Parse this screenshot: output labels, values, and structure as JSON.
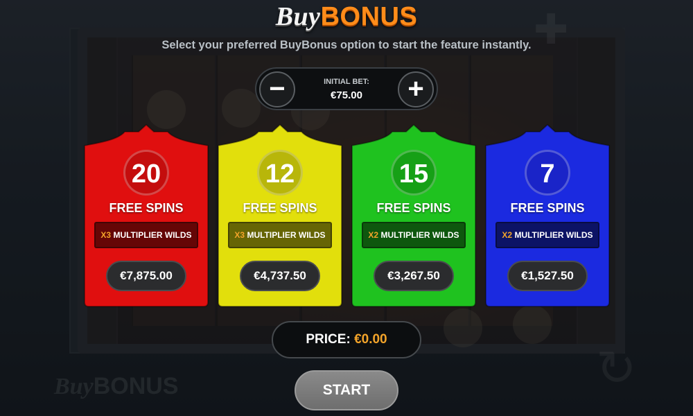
{
  "header": {
    "title_part1": "Buy",
    "title_part2": "BONUS",
    "subtitle": "Select your preferred BuyBonus option to start the feature instantly."
  },
  "bet": {
    "label": "INITIAL BET:",
    "value": "€75.00",
    "minus_symbol": "−",
    "plus_symbol": "+"
  },
  "options": [
    {
      "spins": "20",
      "label": "FREE SPINS",
      "multiplier": "X3",
      "multiplier_text": "MULTIPLIER WILDS",
      "price": "€7,875.00",
      "color": "#e00f0f"
    },
    {
      "spins": "12",
      "label": "FREE SPINS",
      "multiplier": "X3",
      "multiplier_text": "MULTIPLIER WILDS",
      "price": "€4,737.50",
      "color": "#e2df0c"
    },
    {
      "spins": "15",
      "label": "FREE SPINS",
      "multiplier": "X2",
      "multiplier_text": "MULTIPLIER WILDS",
      "price": "€3,267.50",
      "color": "#1fc21f"
    },
    {
      "spins": "7",
      "label": "FREE SPINS",
      "multiplier": "X2",
      "multiplier_text": "MULTIPLIER WILDS",
      "price": "€1,527.50",
      "color": "#1b2ae0"
    }
  ],
  "summary": {
    "price_label": "PRICE:",
    "price_value": "€0.00",
    "start_label": "START"
  },
  "colors": {
    "accent_orange": "#f3a42a",
    "title_orange": "#ff8c1a"
  }
}
